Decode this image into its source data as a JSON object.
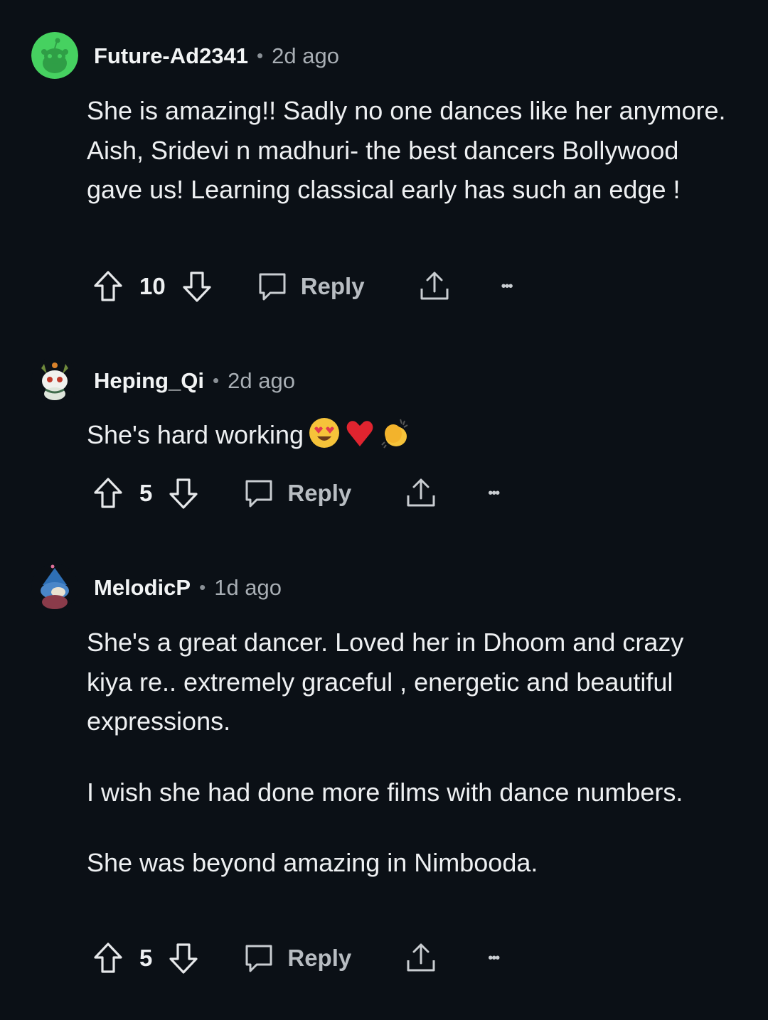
{
  "comments": [
    {
      "username": "Future-Ad2341",
      "separator": "•",
      "time": "2d ago",
      "avatar": "reddit-snoo-green-avatar",
      "paragraphs": [
        "She is amazing!! Sadly no one dances like her anymore. Aish, Sridevi n madhuri- the best dancers Bollywood gave us! Learning classical early has such an edge !"
      ],
      "votes": "10",
      "reply_label": "Reply",
      "more_label": "•••"
    },
    {
      "username": "Heping_Qi",
      "separator": "•",
      "time": "2d ago",
      "avatar": "cat-character-avatar",
      "paragraphs": [
        "She's hard working"
      ],
      "emojis": [
        "heart-eyes-emoji",
        "red-heart-emoji",
        "clapping-hands-emoji"
      ],
      "votes": "5",
      "reply_label": "Reply",
      "more_label": "•••"
    },
    {
      "username": "MelodicP",
      "separator": "•",
      "time": "1d ago",
      "avatar": "wizard-character-avatar",
      "paragraphs": [
        "She's a great dancer. Loved her in Dhoom and crazy kiya re.. extremely graceful , energetic and beautiful expressions.",
        "I wish she had done more films with dance numbers.",
        "She was beyond amazing in Nimbooda."
      ],
      "votes": "5",
      "reply_label": "Reply",
      "more_label": "•••"
    }
  ],
  "colors": {
    "background": "#0b1016",
    "text": "#eef0f2",
    "muted": "#a8aeb4",
    "snoo_green": "#46d160"
  }
}
